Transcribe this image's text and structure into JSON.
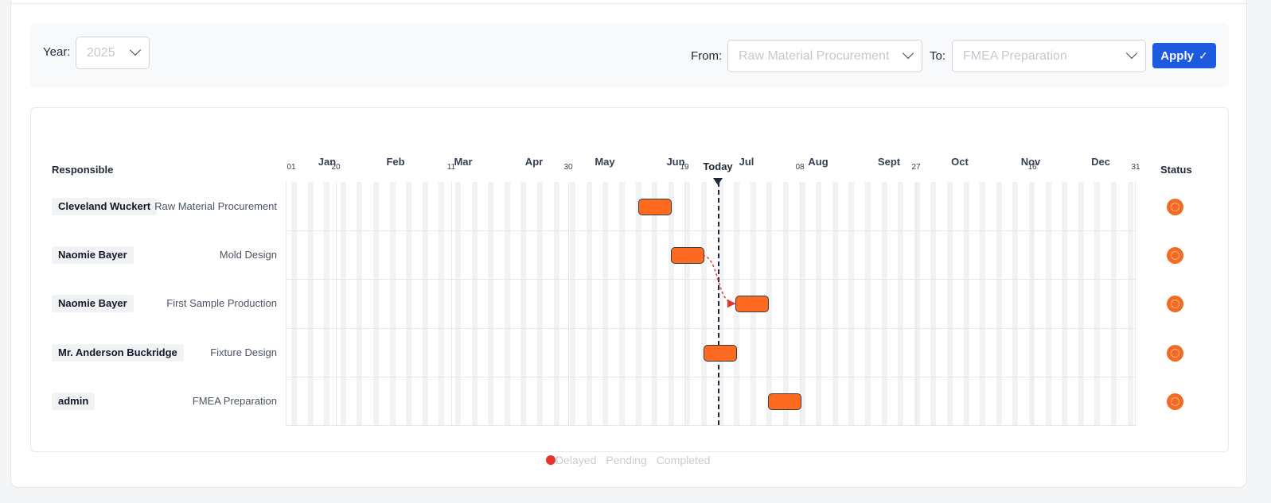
{
  "filters": {
    "year_label": "Year:",
    "year_value": "2025",
    "from_label": "From:",
    "from_value": "Raw Material Procurement",
    "to_label": "To:",
    "to_value": "FMEA Preparation",
    "apply_label": "Apply",
    "apply_icon": "check-icon"
  },
  "gantt": {
    "responsible_header": "Responsible",
    "status_header": "Status",
    "today_label": "Today",
    "months": [
      "Jan",
      "Feb",
      "Mar",
      "Apr",
      "May",
      "Jun",
      "Jul",
      "Aug",
      "Sept",
      "Oct",
      "Nov",
      "Dec"
    ],
    "ticks": [
      "01",
      "20",
      "11",
      "30",
      "19",
      "08",
      "27",
      "16",
      "31"
    ],
    "rows": [
      {
        "responsible": "Cleveland Wuckert",
        "task": "Raw Material Procurement",
        "status_icon": "pending-spinner-icon"
      },
      {
        "responsible": "Naomie Bayer",
        "task": "Mold Design",
        "status_icon": "pending-spinner-icon"
      },
      {
        "responsible": "Naomie Bayer",
        "task": "First Sample Production",
        "status_icon": "pending-spinner-icon"
      },
      {
        "responsible": "Mr. Anderson Buckridge",
        "task": "Fixture Design",
        "status_icon": "pending-spinner-icon"
      },
      {
        "responsible": "admin",
        "task": "FMEA Preparation",
        "status_icon": "pending-spinner-icon"
      }
    ],
    "bar_color": "#ff6a21",
    "dependency_color": "#e5332e"
  },
  "legend": {
    "delayed": "Delayed",
    "pending": "Pending",
    "completed": "Completed",
    "delayed_color": "#e5332e"
  }
}
